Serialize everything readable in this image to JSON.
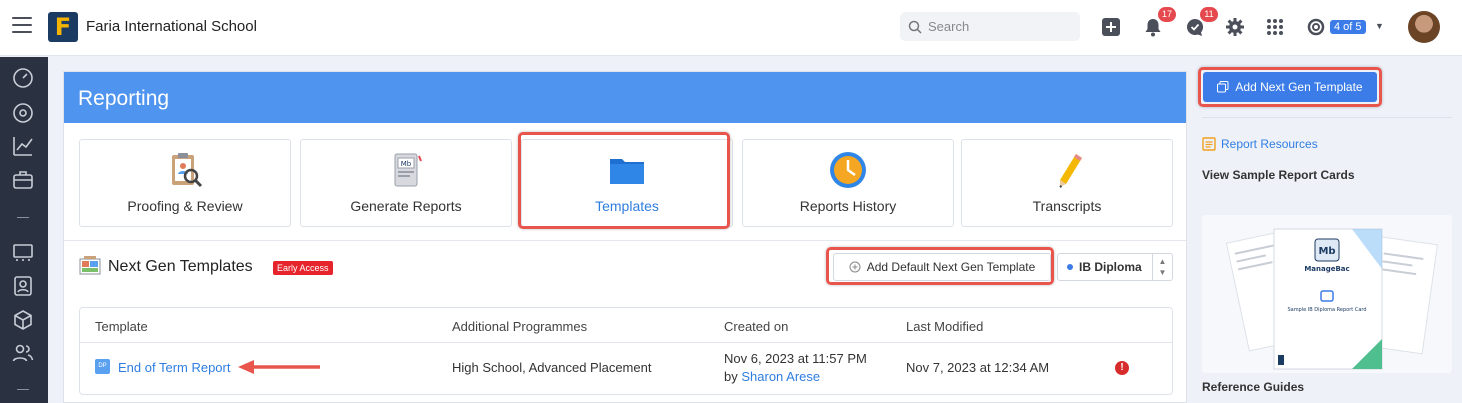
{
  "app": {
    "school_name": "Faria International School",
    "logo_letter": "F"
  },
  "topbar": {
    "search_placeholder": "Search",
    "notifications_count": "17",
    "messages_count": "11",
    "role_switch": "4 of 5"
  },
  "page": {
    "title": "Reporting"
  },
  "tiles": [
    {
      "label": "Proofing & Review",
      "icon": "clipboard-magnifier-icon"
    },
    {
      "label": "Generate Reports",
      "icon": "report-cards-book-icon"
    },
    {
      "label": "Templates",
      "icon": "folder-icon",
      "active": true
    },
    {
      "label": "Reports History",
      "icon": "clock-icon"
    },
    {
      "label": "Transcripts",
      "icon": "pencil-icon"
    }
  ],
  "section": {
    "title": "Next Gen Templates",
    "badge": "Early Access",
    "add_default_label": "Add Default Next Gen Template",
    "programme_select": "IB Diploma"
  },
  "table": {
    "headers": [
      "Template",
      "Additional Programmes",
      "Created on",
      "Last Modified"
    ],
    "rows": [
      {
        "template": "End of Term Report",
        "programmes": "High School, Advanced Placement",
        "created_on": "Nov 6, 2023 at 11:57 PM",
        "created_by_prefix": "by",
        "created_by": "Sharon Arese",
        "last_modified": "Nov 7, 2023 at 12:34 AM"
      }
    ]
  },
  "sidebar_right": {
    "add_template_label": "Add Next Gen Template",
    "report_resources": "Report Resources",
    "sample_heading": "View Sample Report Cards",
    "preview_brand": "ManageBac",
    "preview_caption": "Sample IB Diploma Report Card",
    "reference_guides": "Reference Guides"
  },
  "colors": {
    "header_blue": "#4f94ef",
    "accent": "#3b7ce8",
    "highlight": "#e8554d",
    "sidebar": "#2a3140"
  }
}
